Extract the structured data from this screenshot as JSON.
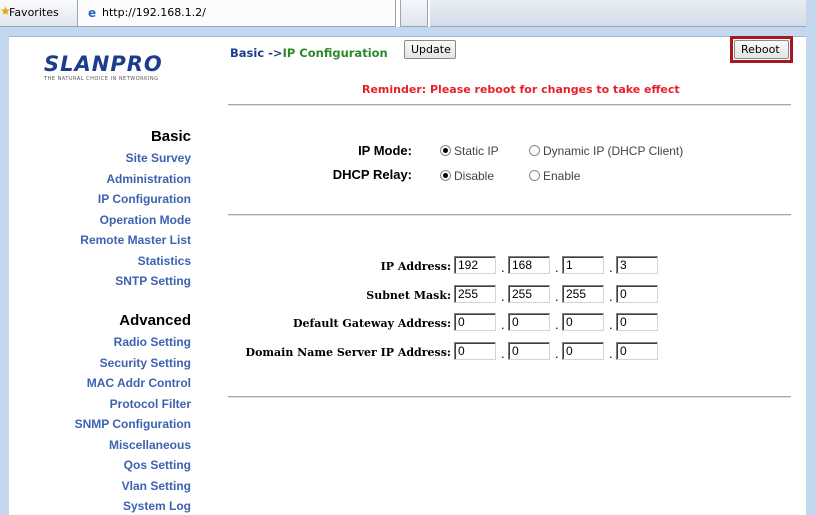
{
  "browser": {
    "favorites_label": "Favorites",
    "tab_url": "http://192.168.1.2/"
  },
  "brand": {
    "name": "LANPRO",
    "tagline": "THE NATURAL CHOICE IN NETWORKING"
  },
  "nav": {
    "basic_heading": "Basic",
    "basic_items": [
      {
        "label": "Site Survey"
      },
      {
        "label": "Administration"
      },
      {
        "label": "IP Configuration"
      },
      {
        "label": "Operation Mode"
      },
      {
        "label": "Remote Master List"
      },
      {
        "label": "Statistics"
      },
      {
        "label": "SNTP Setting"
      }
    ],
    "advanced_heading": "Advanced",
    "advanced_items": [
      {
        "label": "Radio Setting"
      },
      {
        "label": "Security Setting"
      },
      {
        "label": "MAC Addr Control"
      },
      {
        "label": "Protocol Filter"
      },
      {
        "label": "SNMP Configuration"
      },
      {
        "label": "Miscellaneous"
      },
      {
        "label": "Qos Setting"
      },
      {
        "label": "Vlan Setting"
      },
      {
        "label": "System Log"
      }
    ]
  },
  "breadcrumb": {
    "section": "Basic",
    "arrow": "->",
    "page": "IP Configuration"
  },
  "buttons": {
    "update": "Update",
    "reboot": "Reboot"
  },
  "reminder": "Reminder: Please reboot for changes to take effect",
  "modes": {
    "ip_mode_label": "IP Mode:",
    "ip_mode_options": [
      "Static IP",
      "Dynamic IP (DHCP Client)"
    ],
    "ip_mode_selected": "Static IP",
    "dhcp_relay_label": "DHCP Relay:",
    "dhcp_relay_options": [
      "Disable",
      "Enable"
    ],
    "dhcp_relay_selected": "Disable"
  },
  "network": {
    "ip_address": {
      "label": "IP Address:",
      "octets": [
        "192",
        "168",
        "1",
        "3"
      ]
    },
    "subnet_mask": {
      "label": "Subnet Mask:",
      "octets": [
        "255",
        "255",
        "255",
        "0"
      ]
    },
    "gateway": {
      "label": "Default Gateway Address:",
      "octets": [
        "0",
        "0",
        "0",
        "0"
      ]
    },
    "dns": {
      "label": "Domain Name Server IP Address:",
      "octets": [
        "0",
        "0",
        "0",
        "0"
      ]
    }
  }
}
